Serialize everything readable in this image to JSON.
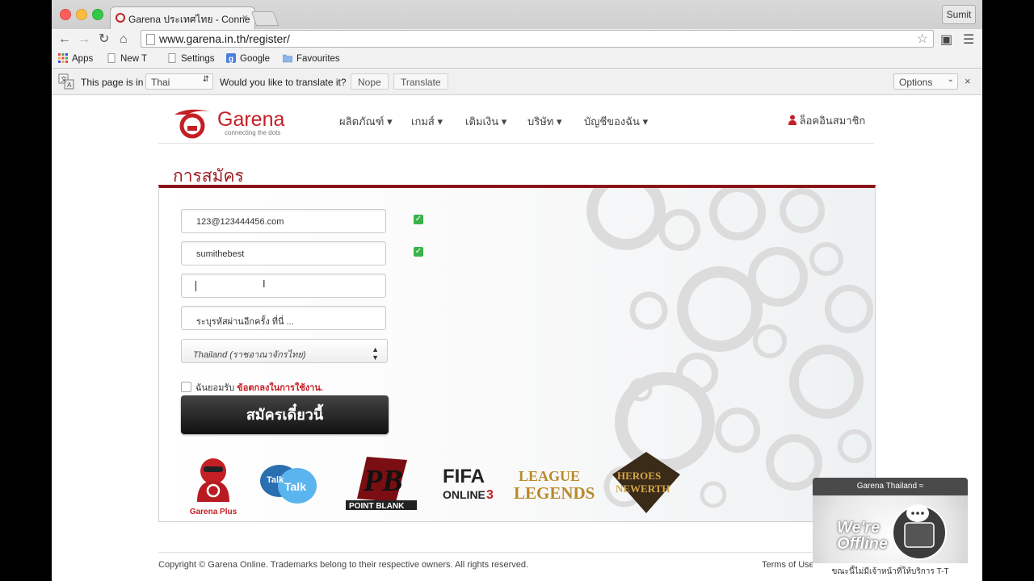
{
  "browser": {
    "tab_title": "Garena ประเทศไทย - Conne",
    "user_button": "Sumit",
    "url": "www.garena.in.th/register/",
    "bookmarks": [
      {
        "label": "Apps",
        "icon": "apps-grid-icon"
      },
      {
        "label": "New T",
        "icon": "page-icon"
      },
      {
        "label": "Settings",
        "icon": "page-icon"
      },
      {
        "label": "Google",
        "icon": "google-icon"
      },
      {
        "label": "Favourites",
        "icon": "folder-icon"
      }
    ],
    "translate": {
      "lead": "This page is in",
      "language": "Thai",
      "question": "Would you like to translate it?",
      "nope": "Nope",
      "translate": "Translate",
      "options": "Options"
    }
  },
  "site": {
    "logo_text": "Garena",
    "logo_tagline": "connecting the dots",
    "nav": [
      "ผลิตภัณฑ์",
      "เกมส์",
      "เติมเงิน",
      "บริษัท",
      "บัญชีของฉัน"
    ],
    "login": "ล็อคอินสมาชิก",
    "page_title": "การสมัคร",
    "form": {
      "email": "123@123444456.com",
      "username": "sumithebest",
      "password": "",
      "confirm_placeholder": "ระบุรหัสผ่านอีกครั้ง ที่นี่ ...",
      "country": "Thailand (ราชอาณาจักรไทย)",
      "agree_text": "ฉันยอมรับ",
      "agree_link": "ข้อตกลงในการใช้งาน.",
      "submit": "สมัครเดี๋ยวนี้"
    },
    "games": [
      {
        "name": "Garena Plus",
        "label": "Garena Plus"
      },
      {
        "name": "Talk Talk",
        "label": ""
      },
      {
        "name": "Point Blank",
        "label": ""
      },
      {
        "name": "FIFA Online 3",
        "label": ""
      },
      {
        "name": "League of Legends",
        "label": ""
      },
      {
        "name": "Heroes of Newerth",
        "label": ""
      }
    ],
    "footer": {
      "copyright": "Copyright © Garena Online. Trademarks belong to their respective owners. All rights reserved.",
      "terms": "Terms of Use"
    }
  },
  "chat_widget": {
    "header": "Garena Thailand",
    "status_line1": "We're",
    "status_line2": "Offline",
    "footer": "ขณะนี้ไม่มีเจ้าหน้าที่ให้บริการ T-T"
  },
  "colors": {
    "brand_red": "#c41f25",
    "title_red": "#9b1c20",
    "check_green": "#3bb34a"
  }
}
